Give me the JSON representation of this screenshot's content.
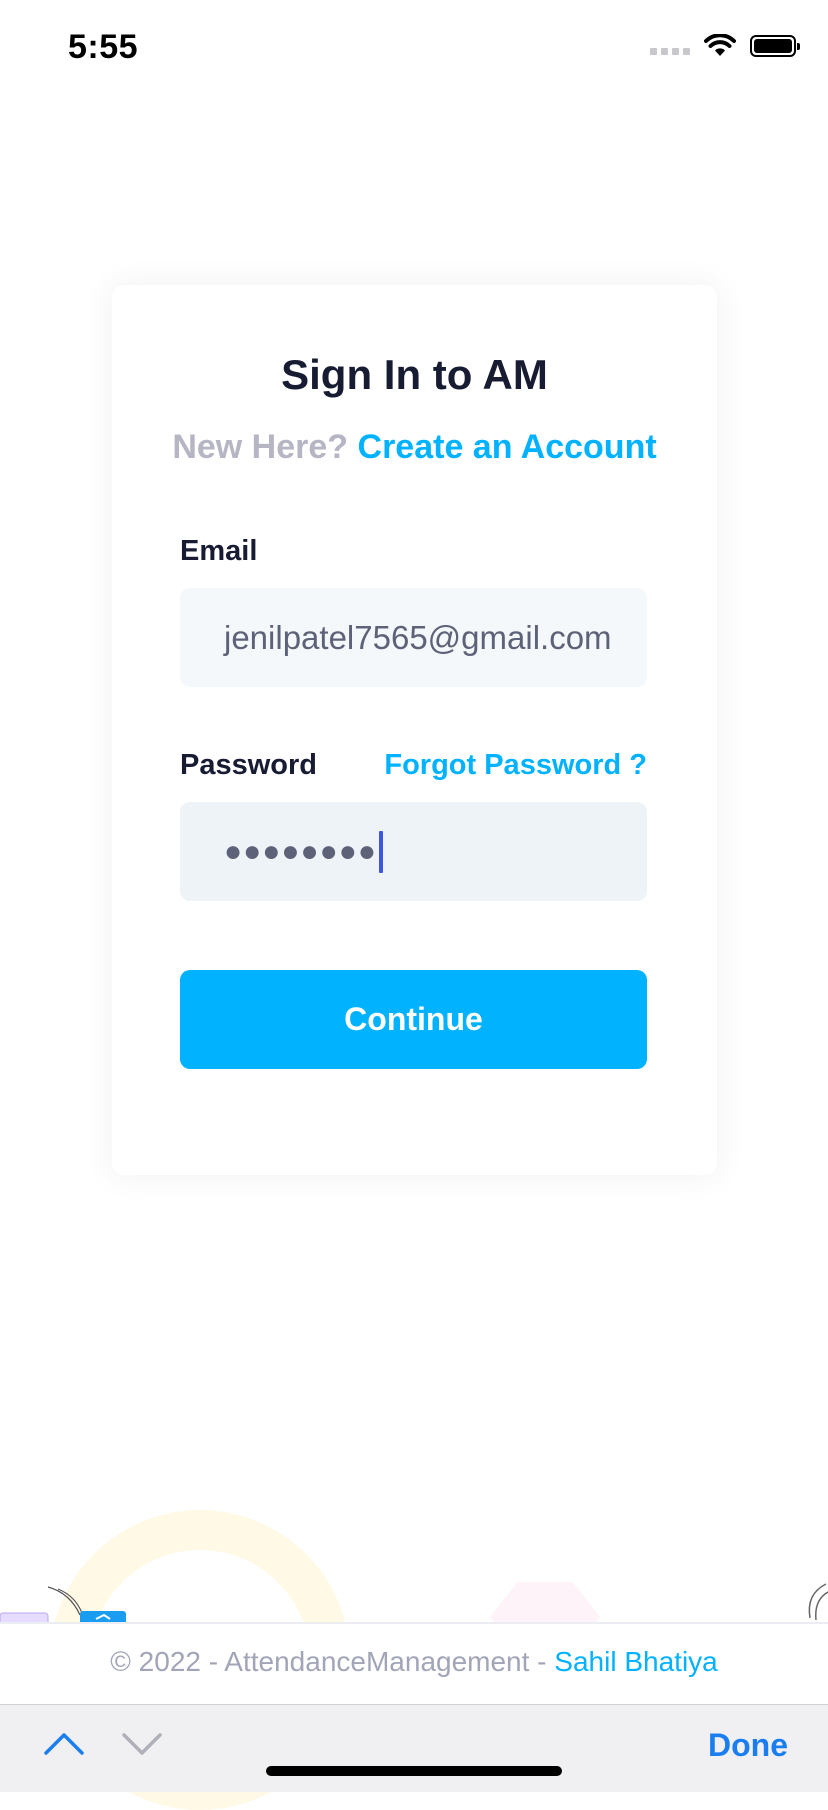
{
  "status_bar": {
    "time": "5:55"
  },
  "sign_in": {
    "title": "Sign In to AM",
    "new_here": "New Here?",
    "create_account_link": "Create an Account",
    "email_label": "Email",
    "email_value": "jenilpatel7565@gmail.com",
    "password_label": "Password",
    "forgot_password_link": "Forgot Password ?",
    "password_masked": "●●●●●●●●",
    "continue_button": "Continue"
  },
  "footer": {
    "copyright": "© 2022 - AttendanceManagement - ",
    "author": "Sahil Bhatiya"
  },
  "keyboard_toolbar": {
    "done_label": "Done"
  },
  "colors": {
    "accent": "#00b2ff",
    "title": "#181c32",
    "muted": "#b5b5c3",
    "field_bg": "#f5f8fa",
    "done": "#1a7ef0"
  }
}
